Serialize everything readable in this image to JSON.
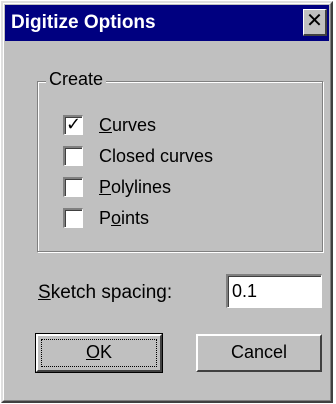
{
  "window": {
    "title": "Digitize Options",
    "close_glyph": "✕"
  },
  "create_group": {
    "legend": "Create",
    "options": [
      {
        "label_underlined": "C",
        "label_rest": "urves",
        "label_prefix": "",
        "checked": true
      },
      {
        "label_underlined": "",
        "label_rest": "Closed curves",
        "label_prefix": "",
        "checked": false
      },
      {
        "label_underlined": "P",
        "label_rest": "olylines",
        "label_prefix": "",
        "checked": false
      },
      {
        "label_prefix": "P",
        "label_underlined": "o",
        "label_rest": "ints",
        "checked": false
      }
    ]
  },
  "sketch_spacing": {
    "label_underlined": "S",
    "label_rest": "ketch spacing:",
    "value": "0.1"
  },
  "buttons": {
    "ok_label": "OK",
    "ok_underlined": "O",
    "ok_rest": "K",
    "cancel_label": "Cancel"
  },
  "checkmark_glyph": "✓",
  "colors": {
    "titlebar": "#000080",
    "face": "#c0c0c0"
  }
}
